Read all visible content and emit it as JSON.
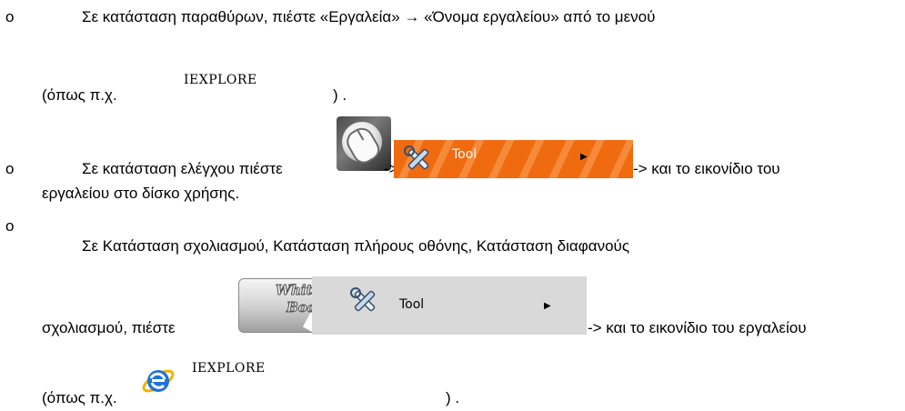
{
  "items": [
    {
      "bullet": "o",
      "line1": "Σε κατάσταση παραθύρων, πιέστε «Εργαλεία» → «Όνομα εργαλείου» από το μενού",
      "line2_prefix": "(όπως π.χ.",
      "example": "IEXPLORE",
      "line2_suffix": ") ."
    },
    {
      "bullet": "o",
      "line1_prefix": "Σε κατάσταση ελέγχου πιέστε",
      "arrow1": "->",
      "tool_label": "Tool",
      "arrow2": "-> και το εικονίδιο του",
      "line2": "εργαλείου στο δίσκο χρήσης."
    },
    {
      "bullet": "o",
      "line1": "Σε Κατάσταση σχολιασμού, Κατάσταση πλήρους οθόνης, Κατάσταση διαφανούς",
      "line2_prefix": "σχολιασμού, πιέστε",
      "wb_word1": "White",
      "wb_word2": "Board",
      "arrow1": "->",
      "tool_label": "Tool",
      "arrow2": "-> και το εικονίδιο του εργαλείου",
      "line3_prefix": "(όπως π.χ.",
      "example": "IEXPLORE",
      "line3_suffix": ") ."
    }
  ],
  "colors": {
    "orange": "#f06a10",
    "gray_bar": "#d9d9d9",
    "ie_blue": "#1f72d8"
  }
}
